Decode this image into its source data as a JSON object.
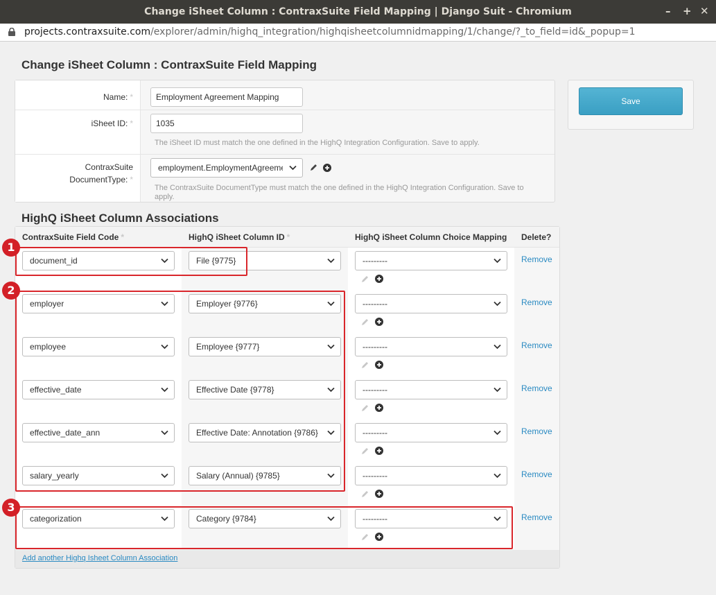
{
  "window": {
    "title": "Change iSheet Column : ContraxSuite Field Mapping | Django Suit - Chromium",
    "minimize": "–",
    "maximize": "+",
    "close": "✕"
  },
  "address_bar": {
    "host": "projects.contraxsuite.com",
    "path": "/explorer/admin/highq_integration/highqisheetcolumnidmapping/1/change/?_to_field=id&_popup=1"
  },
  "page": {
    "title": "Change iSheet Column : ContraxSuite Field Mapping",
    "required_mark": "*",
    "fields": {
      "name": {
        "label": "Name:",
        "value": "Employment Agreement Mapping"
      },
      "isheet_id": {
        "label": "iSheet ID:",
        "value": "1035",
        "help": "The iSheet ID must match the one defined in the HighQ Integration Configuration. Save to apply."
      },
      "document_type": {
        "label_line1": "ContraxSuite",
        "label_line2": "DocumentType:",
        "value": "employment.EmploymentAgreement",
        "help_line1": "The ContraxSuite DocumentType must match the one defined in the HighQ Integration Configuration. Save to",
        "help_line2": "apply."
      }
    },
    "save_label": "Save"
  },
  "associations": {
    "title": "HighQ iSheet Column Associations",
    "columns": {
      "field_code": "ContraxSuite Field Code",
      "column_id": "HighQ iSheet Column ID",
      "choice_mapping": "HighQ iSheet Column Choice Mapping",
      "delete": "Delete?"
    },
    "rows": [
      {
        "field_code": "document_id",
        "column_id": "File {9775}",
        "choice": "---------",
        "remove": "Remove"
      },
      {
        "field_code": "employer",
        "column_id": "Employer {9776}",
        "choice": "---------",
        "remove": "Remove"
      },
      {
        "field_code": "employee",
        "column_id": "Employee {9777}",
        "choice": "---------",
        "remove": "Remove"
      },
      {
        "field_code": "effective_date",
        "column_id": "Effective Date {9778}",
        "choice": "---------",
        "remove": "Remove"
      },
      {
        "field_code": "effective_date_ann",
        "column_id": "Effective Date: Annotation {9786}",
        "choice": "---------",
        "remove": "Remove"
      },
      {
        "field_code": "salary_yearly",
        "column_id": "Salary (Annual) {9785}",
        "choice": "---------",
        "remove": "Remove"
      },
      {
        "field_code": "categorization",
        "column_id": "Category {9784}",
        "choice": "---------",
        "remove": "Remove"
      }
    ],
    "add_link": "Add another Highq Isheet Column Association"
  },
  "annotations": [
    {
      "label": "1"
    },
    {
      "label": "2"
    },
    {
      "label": "3"
    }
  ],
  "colors": {
    "annotation_red": "#d9262b",
    "link_blue": "#2a8ac2",
    "save_button": "#3a9fc3"
  }
}
